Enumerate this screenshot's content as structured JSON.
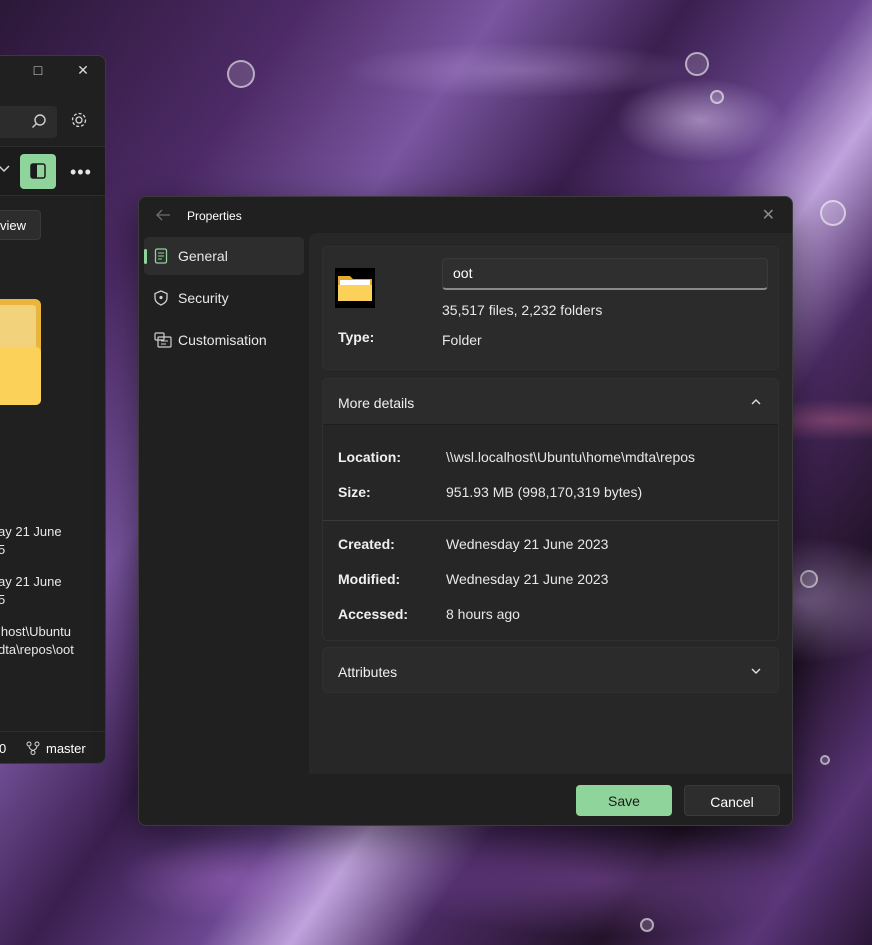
{
  "explorer": {
    "view_label": "view",
    "created_line1": "ay 21 June",
    "created_line2": "5",
    "modified_line1": "ay 21 June",
    "modified_line2": "5",
    "path_line1": "lhost\\Ubuntu",
    "path_line2": "dta\\repos\\oot",
    "status_count": "0",
    "branch": "master"
  },
  "dialog": {
    "title": "Properties",
    "nav": [
      {
        "label": "General",
        "icon": "document-icon",
        "active": true
      },
      {
        "label": "Security",
        "icon": "shield-icon",
        "active": false
      },
      {
        "label": "Customisation",
        "icon": "customise-icon",
        "active": false
      }
    ],
    "general": {
      "name_value": "oot",
      "counts": "35,517 files, 2,232 folders",
      "type_label": "Type:",
      "type_value": "Folder"
    },
    "more_details": {
      "title": "More details",
      "expanded": true,
      "location_label": "Location:",
      "location_value": "\\\\wsl.localhost\\Ubuntu\\home\\mdta\\repos",
      "size_label": "Size:",
      "size_value": "951.93 MB (998,170,319 bytes)",
      "created_label": "Created:",
      "created_value": "Wednesday 21 June 2023",
      "modified_label": "Modified:",
      "modified_value": "Wednesday 21 June 2023",
      "accessed_label": "Accessed:",
      "accessed_value": "8 hours ago"
    },
    "attributes": {
      "title": "Attributes",
      "expanded": false
    },
    "buttons": {
      "save": "Save",
      "cancel": "Cancel"
    }
  },
  "colors": {
    "accent": "#8fd49a",
    "dialog_bg": "#202020",
    "card_bg": "#2b2b2b"
  }
}
